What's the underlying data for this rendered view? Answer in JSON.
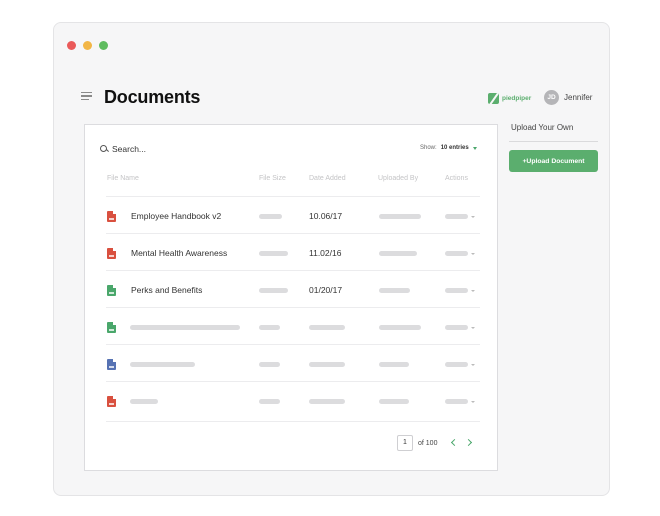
{
  "colors": {
    "close": "#ea5a5a",
    "minimize": "#f2b646",
    "maximize": "#5fbc5f",
    "accent": "#5bae6e",
    "file_red": "#d9503f",
    "file_green": "#4aa76b",
    "file_blue": "#5672b3"
  },
  "header": {
    "title": "Documents",
    "brand_name": "piedpiper",
    "user_initials": "JD",
    "user_name": "Jennifer"
  },
  "toolbar": {
    "search_placeholder": "Search...",
    "show_label": "Show:",
    "show_value": "10 entries"
  },
  "table": {
    "columns": [
      "File Name",
      "File Size",
      "Date Added",
      "Uploaded By",
      "Actions"
    ],
    "rows": [
      {
        "icon": "file-red-icon",
        "name": "Employee Handbook v2",
        "date": "10.06/17"
      },
      {
        "icon": "file-red-icon",
        "name": "Mental Health Awareness",
        "date": "11.02/16"
      },
      {
        "icon": "file-green-icon",
        "name": "Perks and Benefits",
        "date": "01/20/17"
      },
      {
        "icon": "file-green-icon",
        "name": "",
        "date": ""
      },
      {
        "icon": "file-blue-icon",
        "name": "",
        "date": ""
      },
      {
        "icon": "file-red-icon",
        "name": "",
        "date": ""
      }
    ]
  },
  "pagination": {
    "current_page": "1",
    "of_label": "of 100"
  },
  "sidebar": {
    "upload_title": "Upload Your Own",
    "upload_button": "+Upload Document"
  }
}
